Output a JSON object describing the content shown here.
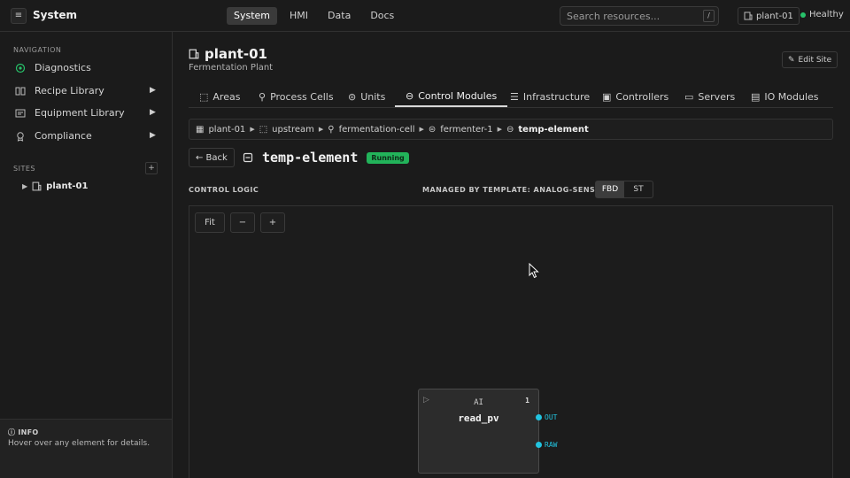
{
  "topbar": {
    "menu_icon": "hamburger-icon",
    "title": "System",
    "nav": [
      "System",
      "HMI",
      "Data",
      "Docs"
    ],
    "search_placeholder": "Search resources...",
    "search_shortcut": "/",
    "site": "plant-01",
    "health": "Healthy",
    "health_color": "#27c26a"
  },
  "sidebar": {
    "nav_heading": "NAVIGATION",
    "items": [
      {
        "label": "Diagnostics",
        "icon": "target-icon"
      },
      {
        "label": "Recipe Library",
        "icon": "book-icon"
      },
      {
        "label": "Equipment Library",
        "icon": "equipment-icon"
      },
      {
        "label": "Compliance",
        "icon": "award-icon"
      }
    ],
    "sites_heading": "SITES",
    "sites_add": "+",
    "site": "plant-01",
    "info_title": "INFO",
    "info_text": "Hover over any element for details."
  },
  "main": {
    "title": "plant-01",
    "subtitle": "Fermentation Plant",
    "edit_label": "Edit Site",
    "tabs": [
      "Areas",
      "Process Cells",
      "Units",
      "Control Modules",
      "Infrastructure",
      "Controllers",
      "Servers",
      "IO Modules"
    ],
    "active_tab": "Control Modules",
    "breadcrumb": [
      "plant-01",
      "upstream",
      "fermentation-cell",
      "fermenter-1",
      "temp-element"
    ],
    "back_label": "← Back",
    "module_name": "temp-element",
    "status": "Running",
    "status_color": "#22b35a",
    "section_label": "CONTROL LOGIC",
    "managed_label": "MANAGED BY TEMPLATE: ANALOG-SENSOR",
    "view_options": [
      "FBD",
      "ST"
    ],
    "active_view": "FBD",
    "canvas_buttons": [
      "Fit",
      "−",
      "+"
    ],
    "block": {
      "type": "AI",
      "name": "read_pv",
      "number": "1",
      "ports": [
        "OUT",
        "RAW"
      ],
      "port_color": "#22c4e0"
    }
  }
}
